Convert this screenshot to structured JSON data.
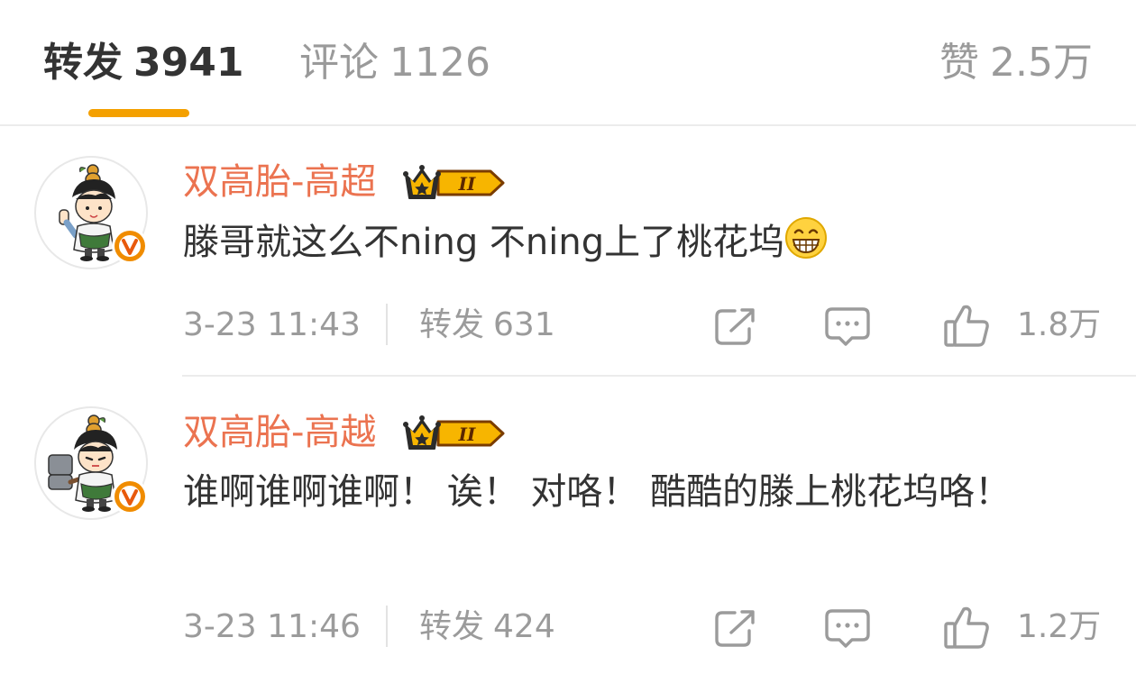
{
  "tabs": {
    "repost": {
      "label": "转发",
      "count": "3941"
    },
    "comment": {
      "label": "评论",
      "count": "1126"
    },
    "like": {
      "label": "赞",
      "count": "2.5万"
    }
  },
  "colors": {
    "accent": "#f4a000",
    "username": "#eb7350",
    "verified": "#f08c00",
    "text": "#333333",
    "muted": "#9b9b9b"
  },
  "comments": [
    {
      "username": "双高胎-高超",
      "vip_badge_text": "II",
      "text": "滕哥就这么不ning 不ning上了桃花坞",
      "emoji": "grin-emoji",
      "timestamp": "3-23 11:43",
      "repost_label": "转发",
      "repost_count": "631",
      "like_count": "1.8万",
      "avatar": "boy-with-gourd-waving-avatar"
    },
    {
      "username": "双高胎-高越",
      "vip_badge_text": "II",
      "text": "谁啊谁啊谁啊！ 诶！ 对咯！ 酷酷的滕上桃花坞咯！",
      "timestamp": "3-23 11:46",
      "repost_label": "转发",
      "repost_count": "424",
      "like_count": "1.2万",
      "avatar": "boy-with-gourd-hammer-avatar"
    }
  ]
}
